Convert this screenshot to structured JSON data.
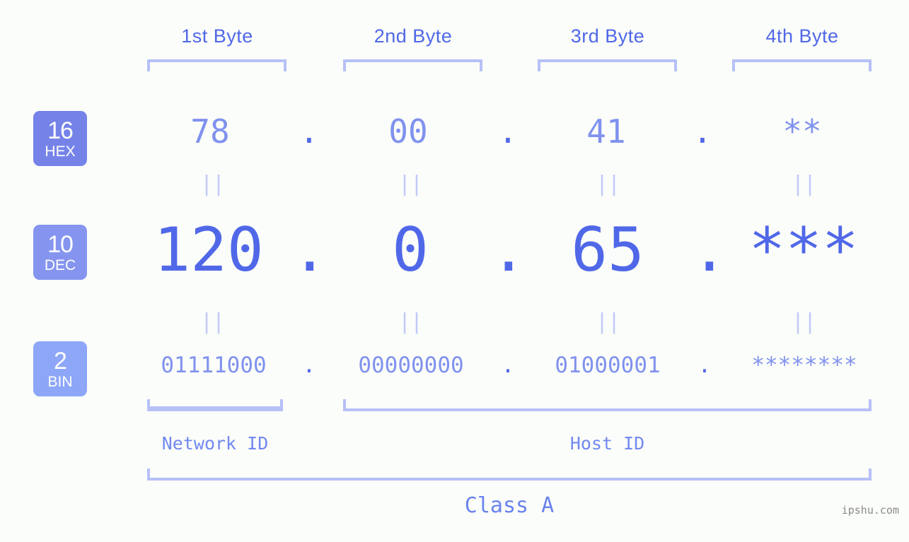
{
  "background_color": "#fbfdfa",
  "accent_strong": "#5068e8",
  "accent_mid": "#8092ee",
  "accent_light": "#b6c0f7",
  "headers": [
    {
      "label": "1st Byte"
    },
    {
      "label": "2nd Byte"
    },
    {
      "label": "3rd Byte"
    },
    {
      "label": "4th Byte"
    }
  ],
  "bases": [
    {
      "number": "16",
      "name": "HEX",
      "color": "#7583e8"
    },
    {
      "number": "10",
      "name": "DEC",
      "color": "#8595ef"
    },
    {
      "number": "2",
      "name": "BIN",
      "color": "#8da6f7"
    }
  ],
  "rows": {
    "hex": {
      "base": "16",
      "base_name": "HEX",
      "values": [
        "78",
        "00",
        "41",
        "**"
      ],
      "separator": "."
    },
    "dec": {
      "base": "10",
      "base_name": "DEC",
      "values": [
        "120",
        "0",
        "65",
        "***"
      ],
      "separator": "."
    },
    "bin": {
      "base": "2",
      "base_name": "BIN",
      "values": [
        "01111000",
        "00000000",
        "01000001",
        "********"
      ],
      "separator": "."
    }
  },
  "equality_marks": [
    "||",
    "||",
    "||",
    "||"
  ],
  "segments": {
    "network_id": "Network ID",
    "host_id": "Host ID"
  },
  "class_label": "Class A",
  "watermark": "ipshu.com"
}
